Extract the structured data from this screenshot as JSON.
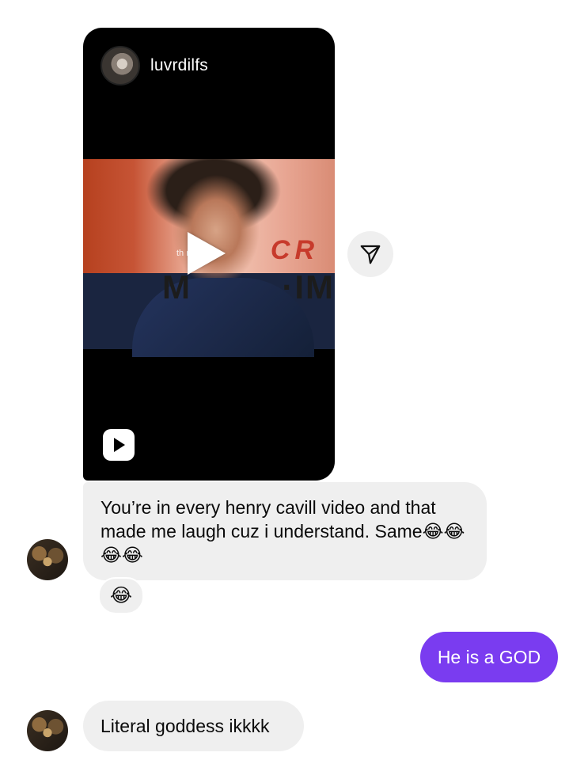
{
  "reel": {
    "username": "luvrdilfs",
    "frame_caption": "th          most",
    "frame_sign_top": "CR",
    "frame_sign_left": "M",
    "frame_sign_right": "·IM"
  },
  "messages": [
    {
      "sender": "other",
      "text": "You’re in every henry cavill video and that made me laugh cuz i understand. Same😂😂😂😂"
    },
    {
      "sender": "other",
      "reaction": "😂"
    },
    {
      "sender": "me",
      "text": "He is a GOD"
    },
    {
      "sender": "other",
      "text": "Literal goddess ikkkk"
    }
  ],
  "colors": {
    "outgoing_bubble": "#7a3cf0",
    "incoming_bubble": "#efefef"
  },
  "icons": [
    "play-icon",
    "reels-icon",
    "share-icon"
  ]
}
